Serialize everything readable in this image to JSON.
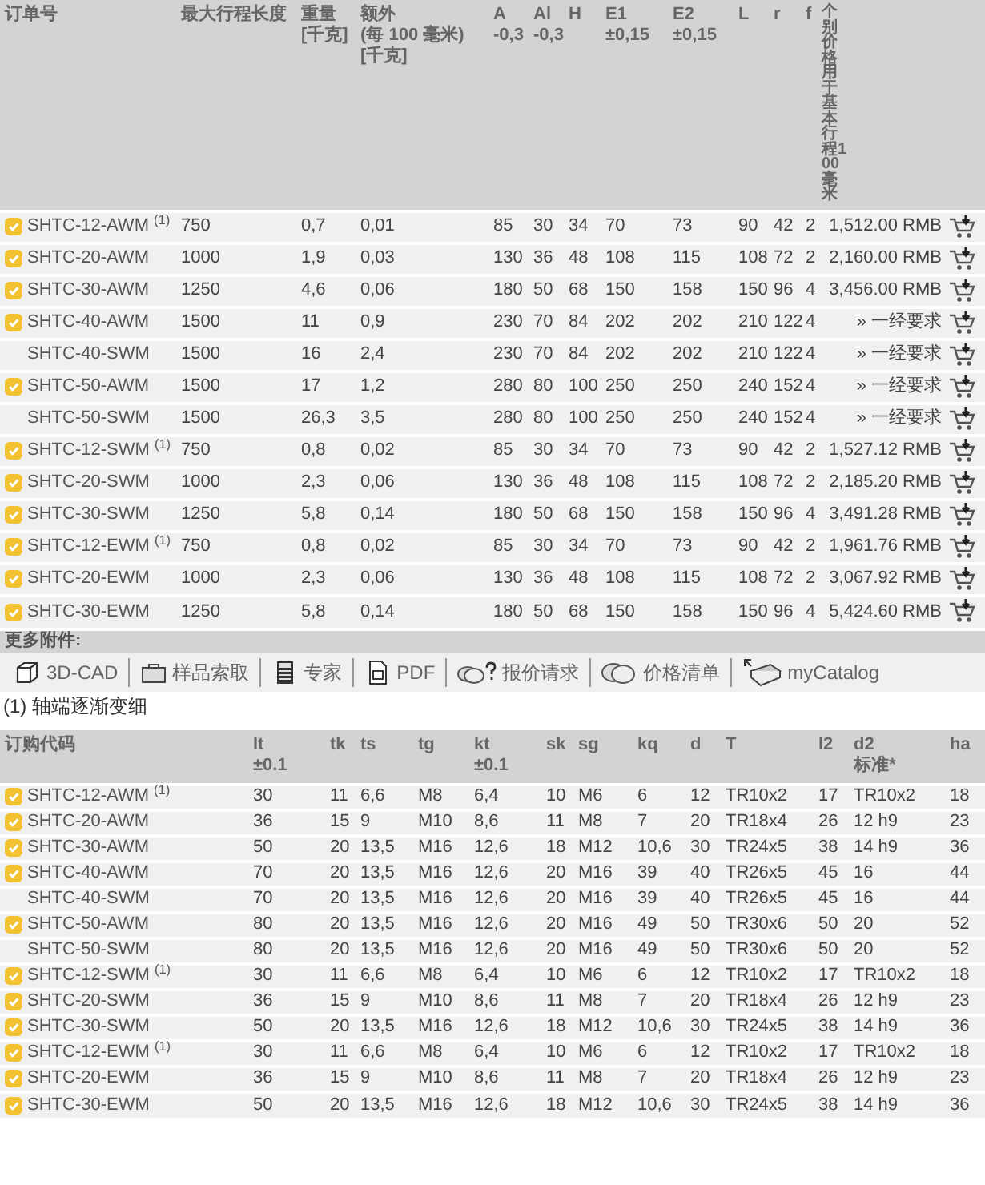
{
  "table1": {
    "order_column": {
      "label": "订单号"
    },
    "columns": [
      {
        "label": "最大行程长度"
      },
      {
        "label": "重量",
        "sub": "[千克]"
      },
      {
        "label": "额外",
        "sub": "(每 100 毫米) [千克]"
      },
      {
        "label": "A",
        "sub": "-0,3"
      },
      {
        "label": "Al",
        "sub": "-0,3"
      },
      {
        "label": "H"
      },
      {
        "label": "E1",
        "sub": "±0,15"
      },
      {
        "label": "E2",
        "sub": "±0,15"
      },
      {
        "label": "L"
      },
      {
        "label": "r"
      },
      {
        "label": "f"
      },
      {
        "label": "个别价格用于基本行程100毫米",
        "kind": "vertical"
      }
    ],
    "rows": [
      {
        "available": true,
        "order": "SHTC-12-AWM $^{(1)}$",
        "cells": [
          "750",
          "0,7",
          "0,01",
          "85",
          "30",
          "34",
          "70",
          "73",
          "90",
          "42",
          "2",
          "1,512.00 RMB"
        ]
      },
      {
        "available": true,
        "order": "SHTC-20-AWM",
        "cells": [
          "1000",
          "1,9",
          "0,03",
          "130",
          "36",
          "48",
          "108",
          "115",
          "108",
          "72",
          "2",
          "2,160.00 RMB"
        ]
      },
      {
        "available": true,
        "order": "SHTC-30-AWM",
        "cells": [
          "1250",
          "4,6",
          "0,06",
          "180",
          "50",
          "68",
          "150",
          "158",
          "150",
          "96",
          "4",
          "3,456.00 RMB"
        ]
      },
      {
        "available": true,
        "order": "SHTC-40-AWM",
        "cells": [
          "1500",
          "11",
          "0,9",
          "230",
          "70",
          "84",
          "202",
          "202",
          "210",
          "122",
          "4",
          "» 一经要求"
        ]
      },
      {
        "available": false,
        "order": "SHTC-40-SWM",
        "cells": [
          "1500",
          "16",
          "2,4",
          "230",
          "70",
          "84",
          "202",
          "202",
          "210",
          "122",
          "4",
          "» 一经要求"
        ]
      },
      {
        "available": true,
        "order": "SHTC-50-AWM",
        "cells": [
          "1500",
          "17",
          "1,2",
          "280",
          "80",
          "100",
          "250",
          "250",
          "240",
          "152",
          "4",
          "» 一经要求"
        ]
      },
      {
        "available": false,
        "order": "SHTC-50-SWM",
        "cells": [
          "1500",
          "26,3",
          "3,5",
          "280",
          "80",
          "100",
          "250",
          "250",
          "240",
          "152",
          "4",
          "» 一经要求"
        ]
      },
      {
        "available": true,
        "order": "SHTC-12-SWM $^{(1)}$",
        "cells": [
          "750",
          "0,8",
          "0,02",
          "85",
          "30",
          "34",
          "70",
          "73",
          "90",
          "42",
          "2",
          "1,527.12 RMB"
        ]
      },
      {
        "available": true,
        "order": "SHTC-20-SWM",
        "cells": [
          "1000",
          "2,3",
          "0,06",
          "130",
          "36",
          "48",
          "108",
          "115",
          "108",
          "72",
          "2",
          "2,185.20 RMB"
        ]
      },
      {
        "available": true,
        "order": "SHTC-30-SWM",
        "cells": [
          "1250",
          "5,8",
          "0,14",
          "180",
          "50",
          "68",
          "150",
          "158",
          "150",
          "96",
          "4",
          "3,491.28 RMB"
        ]
      },
      {
        "available": true,
        "order": "SHTC-12-EWM $^{(1)}$",
        "cells": [
          "750",
          "0,8",
          "0,02",
          "85",
          "30",
          "34",
          "70",
          "73",
          "90",
          "42",
          "2",
          "1,961.76 RMB"
        ]
      },
      {
        "available": true,
        "order": "SHTC-20-EWM",
        "cells": [
          "1000",
          "2,3",
          "0,06",
          "130",
          "36",
          "48",
          "108",
          "115",
          "108",
          "72",
          "2",
          "3,067.92 RMB"
        ]
      },
      {
        "available": true,
        "order": "SHTC-30-EWM",
        "cells": [
          "1250",
          "5,8",
          "0,14",
          "180",
          "50",
          "68",
          "150",
          "158",
          "150",
          "96",
          "4",
          "5,424.60 RMB"
        ]
      }
    ]
  },
  "accessories": {
    "title": "更多附件:",
    "tools": [
      {
        "kind": "cad",
        "label": "3D-CAD"
      },
      {
        "kind": "sample",
        "label": "样品索取"
      },
      {
        "kind": "expert",
        "label": "专家"
      },
      {
        "kind": "pdf",
        "label": "PDF"
      },
      {
        "kind": "quote",
        "label": "报价请求"
      },
      {
        "kind": "pricelist",
        "label": "价格清单"
      },
      {
        "kind": "catalog",
        "label": "myCatalog"
      }
    ]
  },
  "footnote": "(1) 轴端逐渐变细",
  "table2": {
    "order_column": {
      "label": "订购代码"
    },
    "columns": [
      {
        "label": "lt",
        "sub": "±0.1"
      },
      {
        "label": "tk"
      },
      {
        "label": "ts"
      },
      {
        "label": "tg"
      },
      {
        "label": "kt",
        "sub": "±0.1"
      },
      {
        "label": "sk"
      },
      {
        "label": "sg"
      },
      {
        "label": "kq"
      },
      {
        "label": "d"
      },
      {
        "label": "T"
      },
      {
        "label": "l2"
      },
      {
        "label": "d2",
        "sub": "标准*"
      },
      {
        "label": "ha"
      }
    ],
    "rows": [
      {
        "available": true,
        "order": "SHTC-12-AWM $^{(1)}$",
        "cells": [
          "30",
          "11",
          "6,6",
          "M8",
          "6,4",
          "10",
          "M6",
          "6",
          "12",
          "TR10x2",
          "17",
          "TR10x2",
          "18"
        ]
      },
      {
        "available": true,
        "order": "SHTC-20-AWM",
        "cells": [
          "36",
          "15",
          "9",
          "M10",
          "8,6",
          "11",
          "M8",
          "7",
          "20",
          "TR18x4",
          "26",
          "12 h9",
          "23"
        ]
      },
      {
        "available": true,
        "order": "SHTC-30-AWM",
        "cells": [
          "50",
          "20",
          "13,5",
          "M16",
          "12,6",
          "18",
          "M12",
          "10,6",
          "30",
          "TR24x5",
          "38",
          "14 h9",
          "36"
        ]
      },
      {
        "available": true,
        "order": "SHTC-40-AWM",
        "cells": [
          "70",
          "20",
          "13,5",
          "M16",
          "12,6",
          "20",
          "M16",
          "39",
          "40",
          "TR26x5",
          "45",
          "16",
          "44"
        ]
      },
      {
        "available": false,
        "order": "SHTC-40-SWM",
        "cells": [
          "70",
          "20",
          "13,5",
          "M16",
          "12,6",
          "20",
          "M16",
          "39",
          "40",
          "TR26x5",
          "45",
          "16",
          "44"
        ]
      },
      {
        "available": true,
        "order": "SHTC-50-AWM",
        "cells": [
          "80",
          "20",
          "13,5",
          "M16",
          "12,6",
          "20",
          "M16",
          "49",
          "50",
          "TR30x6",
          "50",
          "20",
          "52"
        ]
      },
      {
        "available": false,
        "order": "SHTC-50-SWM",
        "cells": [
          "80",
          "20",
          "13,5",
          "M16",
          "12,6",
          "20",
          "M16",
          "49",
          "50",
          "TR30x6",
          "50",
          "20",
          "52"
        ]
      },
      {
        "available": true,
        "order": "SHTC-12-SWM $^{(1)}$",
        "cells": [
          "30",
          "11",
          "6,6",
          "M8",
          "6,4",
          "10",
          "M6",
          "6",
          "12",
          "TR10x2",
          "17",
          "TR10x2",
          "18"
        ]
      },
      {
        "available": true,
        "order": "SHTC-20-SWM",
        "cells": [
          "36",
          "15",
          "9",
          "M10",
          "8,6",
          "11",
          "M8",
          "7",
          "20",
          "TR18x4",
          "26",
          "12 h9",
          "23"
        ]
      },
      {
        "available": true,
        "order": "SHTC-30-SWM",
        "cells": [
          "50",
          "20",
          "13,5",
          "M16",
          "12,6",
          "18",
          "M12",
          "10,6",
          "30",
          "TR24x5",
          "38",
          "14 h9",
          "36"
        ]
      },
      {
        "available": true,
        "order": "SHTC-12-EWM $^{(1)}$",
        "cells": [
          "30",
          "11",
          "6,6",
          "M8",
          "6,4",
          "10",
          "M6",
          "6",
          "12",
          "TR10x2",
          "17",
          "TR10x2",
          "18"
        ]
      },
      {
        "available": true,
        "order": "SHTC-20-EWM",
        "cells": [
          "36",
          "15",
          "9",
          "M10",
          "8,6",
          "11",
          "M8",
          "7",
          "20",
          "TR18x4",
          "26",
          "12 h9",
          "23"
        ]
      },
      {
        "available": true,
        "order": "SHTC-30-EWM",
        "cells": [
          "50",
          "20",
          "13,5",
          "M16",
          "12,6",
          "18",
          "M12",
          "10,6",
          "30",
          "TR24x5",
          "38",
          "14 h9",
          "36"
        ]
      }
    ]
  }
}
